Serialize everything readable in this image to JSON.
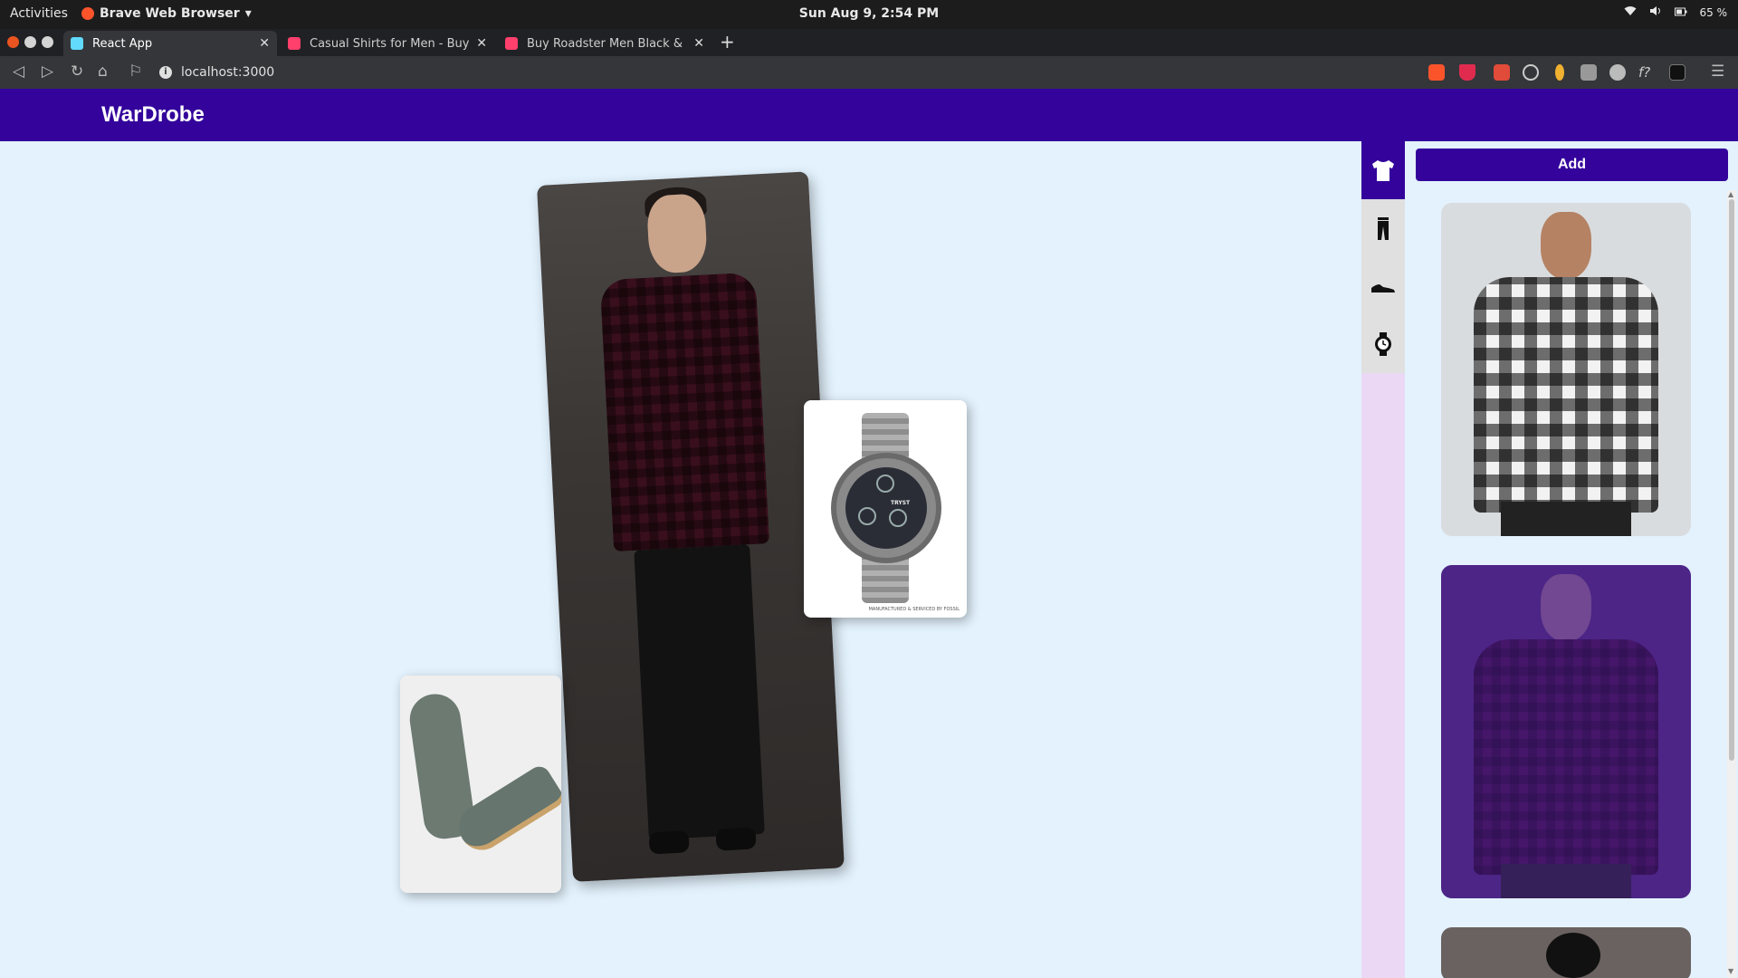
{
  "system_bar": {
    "activities": "Activities",
    "app_name": "Brave Web Browser",
    "clock": "Sun Aug  9,  2:54 PM",
    "battery": "65 %"
  },
  "browser": {
    "tabs": [
      {
        "title": "React App",
        "active": true
      },
      {
        "title": "Casual Shirts for Men - Buy Men",
        "active": false
      },
      {
        "title": "Buy Roadster Men Black & Grey",
        "active": false
      }
    ],
    "url": "localhost:3000"
  },
  "app": {
    "title": "WarDrobe",
    "add_button": "Add",
    "categories": [
      {
        "icon": "shirt-icon",
        "active": true
      },
      {
        "icon": "pants-icon",
        "active": false
      },
      {
        "icon": "shoe-icon",
        "active": false
      },
      {
        "icon": "watch-icon",
        "active": false
      }
    ],
    "watch_brand": "TRYST",
    "watch_fine_print": "MANUFACTURED & SERVICED BY FOSSIL"
  },
  "colors": {
    "brand": "#33039b",
    "canvas_bg": "#e3f2fd",
    "category_bg": "#ead8f4"
  }
}
